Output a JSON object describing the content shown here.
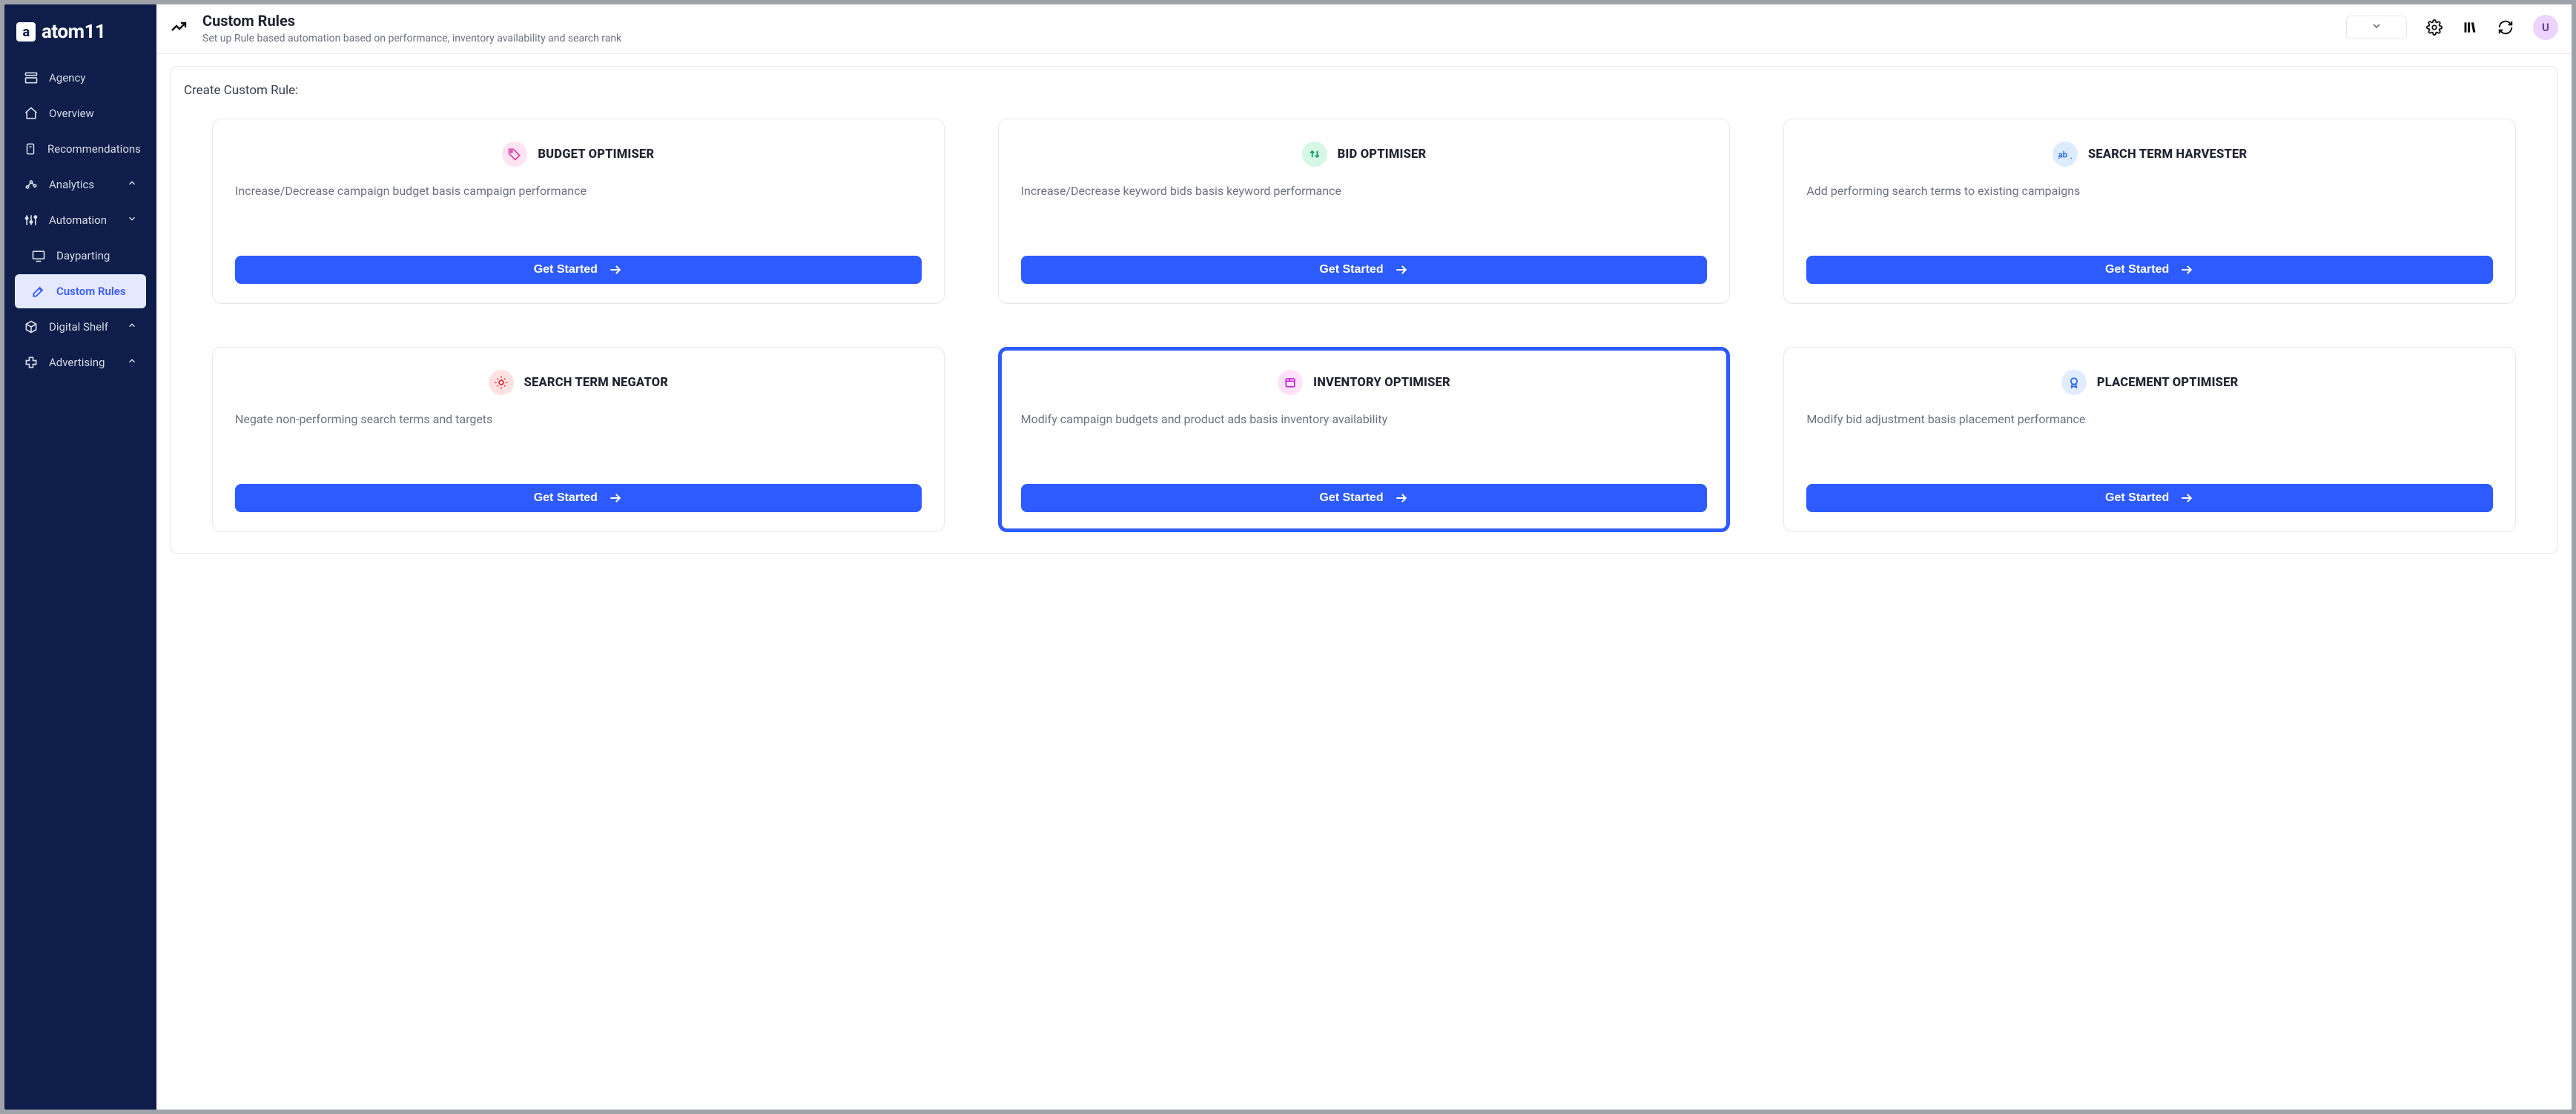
{
  "brand": {
    "mark_letter": "a",
    "name": "atom11"
  },
  "sidebar": {
    "items": [
      {
        "label": "Agency"
      },
      {
        "label": "Overview"
      },
      {
        "label": "Recommendations"
      },
      {
        "label": "Analytics"
      },
      {
        "label": "Automation"
      },
      {
        "label": "Dayparting"
      },
      {
        "label": "Custom Rules"
      },
      {
        "label": "Digital Shelf"
      },
      {
        "label": "Advertising"
      }
    ]
  },
  "header": {
    "title": "Custom Rules",
    "subtitle": "Set up Rule based automation based on performance, inventory availability and search rank",
    "avatar_initial": "U"
  },
  "main": {
    "panel_title": "Create Custom Rule:",
    "get_started_label": "Get Started",
    "cards": [
      {
        "title": "BUDGET OPTIMISER",
        "desc": "Increase/Decrease campaign budget basis campaign performance",
        "icon": "tag",
        "circ_bg": "#ffe3f2",
        "circ_fg": "#d6409f"
      },
      {
        "title": "BID OPTIMISER",
        "desc": "Increase/Decrease keyword bids basis keyword performance",
        "icon": "swap-vertical",
        "circ_bg": "#d5f7e4",
        "circ_fg": "#059669"
      },
      {
        "title": "SEARCH TERM HARVESTER",
        "desc": "Add performing search terms to existing campaigns",
        "icon": "ab",
        "circ_bg": "#dcecff",
        "circ_fg": "#2563eb"
      },
      {
        "title": "SEARCH TERM NEGATOR",
        "desc": "Negate non-performing search terms and targets",
        "icon": "cog-alert",
        "circ_bg": "#ffe1e1",
        "circ_fg": "#dc2626"
      },
      {
        "title": "INVENTORY OPTIMISER",
        "desc": "Modify campaign budgets and product ads basis inventory availability",
        "icon": "package",
        "circ_bg": "#ffe2f9",
        "circ_fg": "#c026d3",
        "highlight": true
      },
      {
        "title": "PLACEMENT OPTIMISER",
        "desc": "Modify bid adjustment basis placement performance",
        "icon": "badge",
        "circ_bg": "#e1ecff",
        "circ_fg": "#2563eb"
      }
    ]
  }
}
